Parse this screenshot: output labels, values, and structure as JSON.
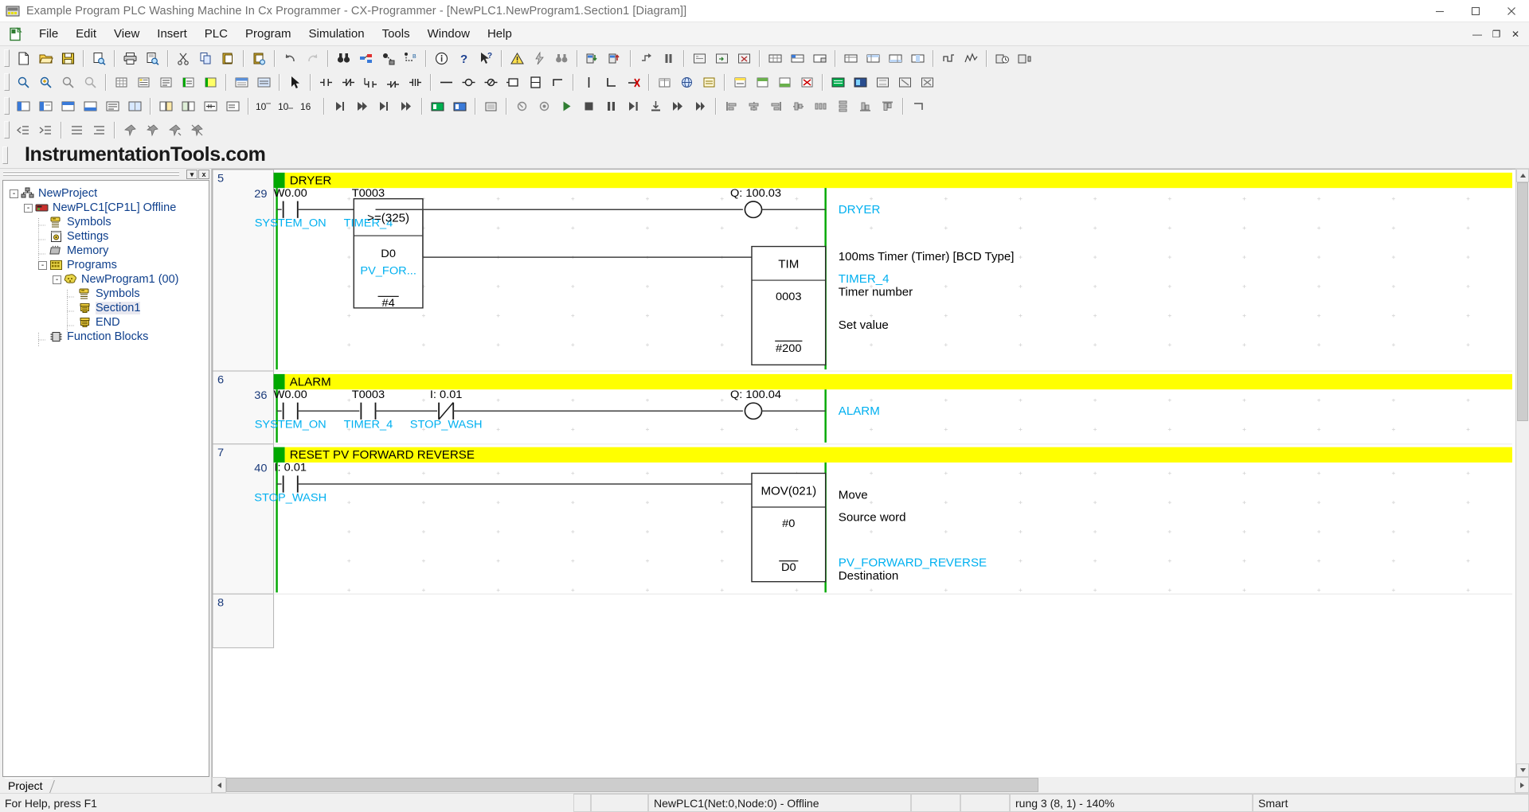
{
  "window": {
    "title": "Example Program PLC Washing Machine In Cx Programmer - CX-Programmer - [NewPLC1.NewProgram1.Section1 [Diagram]]",
    "app_icon": "plc-app-icon",
    "minimize": "minimize-icon",
    "maximize": "maximize-icon",
    "close": "close-icon"
  },
  "menubar": {
    "doc_icon": "document-icon",
    "items": [
      {
        "label": "File"
      },
      {
        "label": "Edit"
      },
      {
        "label": "View"
      },
      {
        "label": "Insert"
      },
      {
        "label": "PLC"
      },
      {
        "label": "Program"
      },
      {
        "label": "Simulation"
      },
      {
        "label": "Tools"
      },
      {
        "label": "Window"
      },
      {
        "label": "Help"
      }
    ],
    "mdi": [
      {
        "name": "mdi-minimize",
        "glyph": "—"
      },
      {
        "name": "mdi-restore",
        "glyph": "❐"
      },
      {
        "name": "mdi-close",
        "glyph": "✕"
      }
    ]
  },
  "brand": {
    "text": "InstrumentationTools.com"
  },
  "toolbars": {
    "row1": [
      {
        "name": "new-file-button",
        "icon": "new-document-icon"
      },
      {
        "name": "open-file-button",
        "icon": "open-folder-icon"
      },
      {
        "name": "save-file-button",
        "icon": "floppy-save-icon"
      },
      {
        "sep": true
      },
      {
        "name": "print-setup-button",
        "icon": "page-magnifier-icon"
      },
      {
        "sep": true
      },
      {
        "name": "print-button",
        "icon": "printer-icon"
      },
      {
        "name": "print-preview-button",
        "icon": "preview-page-icon"
      },
      {
        "sep": true
      },
      {
        "name": "cut-button",
        "icon": "scissors-icon"
      },
      {
        "name": "copy-button",
        "icon": "copy-icon"
      },
      {
        "name": "paste-button",
        "icon": "clipboard-paste-icon"
      },
      {
        "sep": true
      },
      {
        "name": "paste-special-button",
        "icon": "clipboard-special-icon"
      },
      {
        "sep": true
      },
      {
        "name": "undo-button",
        "icon": "undo-arrow-icon"
      },
      {
        "name": "redo-button",
        "icon": "redo-arrow-icon"
      },
      {
        "sep": true
      },
      {
        "name": "find-button",
        "icon": "binoculars-icon"
      },
      {
        "name": "replace-button",
        "icon": "find-replace-icon"
      },
      {
        "name": "go-to-button",
        "icon": "jump-to-icon"
      },
      {
        "name": "cross-reference-button",
        "icon": "cross-reference-icon"
      },
      {
        "sep": true
      },
      {
        "name": "properties-button",
        "icon": "info-circle-icon"
      },
      {
        "name": "help-button",
        "icon": "question-mark-icon"
      },
      {
        "name": "context-help-button",
        "icon": "help-pointer-icon"
      },
      {
        "sep": true
      },
      {
        "name": "compile-warning-button",
        "icon": "warning-triangle-icon"
      },
      {
        "name": "program-check-button",
        "icon": "lightning-check-icon"
      },
      {
        "name": "error-search-button",
        "icon": "error-search-icon"
      },
      {
        "sep": true
      },
      {
        "name": "transfer-to-plc-button",
        "icon": "download-plc-icon"
      },
      {
        "name": "transfer-from-plc-button",
        "icon": "upload-plc-icon"
      },
      {
        "sep": true
      },
      {
        "name": "step-run-button",
        "icon": "step-run-icon"
      },
      {
        "name": "pause-button",
        "icon": "pause-icon"
      },
      {
        "sep": true
      },
      {
        "name": "online-edit-begin-button",
        "icon": "online-edit-icon"
      },
      {
        "name": "online-edit-send-button",
        "icon": "online-send-icon"
      },
      {
        "name": "online-edit-cancel-button",
        "icon": "online-cancel-icon"
      },
      {
        "sep": true
      },
      {
        "name": "memory-view-button",
        "icon": "memory-view-icon"
      },
      {
        "name": "memory-edit-button",
        "icon": "memory-edit-icon"
      },
      {
        "name": "memory-transfer-button",
        "icon": "memory-transfer-icon"
      },
      {
        "sep": true
      },
      {
        "name": "watch-window-button",
        "icon": "watch-window-icon"
      },
      {
        "name": "watch-window-b-button",
        "icon": "watch-window-b-icon"
      },
      {
        "name": "watch-window-c-button",
        "icon": "watch-window-c-icon"
      },
      {
        "name": "watch-window-d-button",
        "icon": "watch-window-d-icon"
      },
      {
        "sep": true
      },
      {
        "name": "differential-monitor-button",
        "icon": "differential-monitor-icon"
      },
      {
        "name": "data-trace-button",
        "icon": "data-trace-icon"
      },
      {
        "sep": true
      },
      {
        "name": "plc-clock-button",
        "icon": "plc-clock-icon"
      },
      {
        "name": "plc-settings-button",
        "icon": "plc-settings-icon"
      }
    ],
    "row2": [
      {
        "name": "zoom-pointer-button",
        "icon": "zoom-pointer-icon"
      },
      {
        "name": "zoom-in-button",
        "icon": "zoom-in-icon"
      },
      {
        "name": "zoom-out-button",
        "icon": "zoom-out-icon"
      },
      {
        "name": "zoom-fit-button",
        "icon": "zoom-fit-icon"
      },
      {
        "sep": true
      },
      {
        "name": "toggle-grid-button",
        "icon": "grid-icon"
      },
      {
        "name": "show-symbols-button",
        "icon": "symbol-list-icon"
      },
      {
        "name": "show-comments-button",
        "icon": "comment-list-icon"
      },
      {
        "name": "show-rung-comments-button",
        "icon": "rung-comment-icon"
      },
      {
        "name": "show-bar-button",
        "icon": "bar-icon"
      },
      {
        "sep": true
      },
      {
        "name": "address-display-button",
        "icon": "address-display-icon"
      },
      {
        "name": "monitor-display-button",
        "icon": "monitor-display-icon"
      },
      {
        "sep": true
      },
      {
        "name": "select-mode-button",
        "icon": "arrow-cursor-icon"
      },
      {
        "sep": true
      },
      {
        "name": "new-contact-button",
        "icon": "contact-no-icon"
      },
      {
        "name": "new-closed-contact-button",
        "icon": "contact-nc-icon"
      },
      {
        "name": "new-contact-or-button",
        "icon": "contact-or-icon"
      },
      {
        "name": "new-closed-contact-or-button",
        "icon": "contact-or-nc-icon"
      },
      {
        "name": "new-contact-ud-button",
        "icon": "contact-ud-icon"
      },
      {
        "sep": true
      },
      {
        "name": "new-horizontal-line-button",
        "icon": "horizontal-line-icon"
      },
      {
        "name": "new-coil-button",
        "icon": "coil-icon"
      },
      {
        "name": "new-closed-coil-button",
        "icon": "coil-nc-icon"
      },
      {
        "name": "new-instruction-button",
        "icon": "instruction-box-icon"
      },
      {
        "name": "new-vertical-instruction-button",
        "icon": "vertical-instruction-icon"
      },
      {
        "name": "new-inline-instruction-button",
        "icon": "inline-instruction-icon"
      },
      {
        "sep": true
      },
      {
        "name": "new-vertical-line-button",
        "icon": "vertical-line-icon"
      },
      {
        "name": "new-corner-line-button",
        "icon": "corner-line-icon"
      },
      {
        "name": "delete-line-button",
        "icon": "delete-line-icon"
      },
      {
        "sep": true
      },
      {
        "name": "symbol-table-button",
        "icon": "symbol-table-icon"
      },
      {
        "name": "global-symbols-button",
        "icon": "global-symbols-icon"
      },
      {
        "name": "local-symbols-button",
        "icon": "local-symbols-icon"
      },
      {
        "sep": true
      },
      {
        "name": "insert-rung-button",
        "icon": "insert-rung-icon"
      },
      {
        "name": "insert-rung-above-button",
        "icon": "insert-rung-above-icon"
      },
      {
        "name": "insert-rung-below-button",
        "icon": "insert-rung-below-icon"
      },
      {
        "name": "delete-rung-button",
        "icon": "delete-rung-icon"
      },
      {
        "sep": true
      },
      {
        "name": "mnemonic-view-button",
        "icon": "mnemonic-view-icon"
      },
      {
        "name": "toggle-bit-button",
        "icon": "toggle-bit-icon"
      },
      {
        "name": "force-on-button",
        "icon": "force-on-icon"
      },
      {
        "name": "force-off-button",
        "icon": "force-off-icon"
      },
      {
        "name": "force-cancel-button",
        "icon": "force-cancel-icon"
      }
    ],
    "row3": [
      {
        "name": "show-program-button",
        "icon": "show-program-icon"
      },
      {
        "name": "show-section-button",
        "icon": "show-section-icon"
      },
      {
        "name": "show-symbol-button",
        "icon": "show-symbol-icon"
      },
      {
        "name": "show-comment-button",
        "icon": "show-comment-icon"
      },
      {
        "name": "show-output-button",
        "icon": "show-output-icon"
      },
      {
        "name": "show-watch-button",
        "icon": "show-watch-icon"
      },
      {
        "sep": true
      },
      {
        "name": "compare-program-button",
        "icon": "compare-program-icon"
      },
      {
        "name": "compare-section-button",
        "icon": "compare-section-icon"
      },
      {
        "name": "view-ladder-button",
        "icon": "view-ladder-icon"
      },
      {
        "name": "view-mnemonics-button",
        "icon": "view-mnemonics-icon"
      },
      {
        "sep": true
      },
      {
        "name": "display-decimal-10-button",
        "icon": "decimal-10-icon",
        "label": "10"
      },
      {
        "name": "display-signed-10-button",
        "icon": "signed-10-icon",
        "label": "10"
      },
      {
        "name": "display-hex-16-button",
        "icon": "hex-16-icon",
        "label": "16"
      },
      {
        "sep": true
      },
      {
        "name": "jump-first-rung-button",
        "icon": "jump-first-icon"
      },
      {
        "name": "jump-prev-rung-button",
        "icon": "jump-prev-icon"
      },
      {
        "name": "jump-next-rung-button",
        "icon": "jump-next-icon"
      },
      {
        "name": "jump-last-rung-button",
        "icon": "jump-last-icon"
      },
      {
        "sep": true
      },
      {
        "name": "work-online-button",
        "icon": "work-online-icon"
      },
      {
        "name": "work-online-simulator-button",
        "icon": "simulator-online-icon"
      },
      {
        "sep": true
      },
      {
        "name": "plc-mode-button",
        "icon": "plc-mode-icon"
      },
      {
        "sep": true
      },
      {
        "name": "sim-stop-mode-button",
        "icon": "sim-stop-mode-icon"
      },
      {
        "name": "sim-monitor-mode-button",
        "icon": "sim-monitor-mode-icon"
      },
      {
        "name": "sim-run-button",
        "icon": "sim-run-icon"
      },
      {
        "name": "sim-stop-button",
        "icon": "sim-stop-icon"
      },
      {
        "name": "sim-pause-button",
        "icon": "sim-pause-icon"
      },
      {
        "name": "sim-step-button",
        "icon": "sim-step-icon"
      },
      {
        "name": "sim-step-in-button",
        "icon": "sim-step-in-icon"
      },
      {
        "name": "sim-continuous-step-button",
        "icon": "sim-continuous-step-icon"
      },
      {
        "name": "sim-scan-button",
        "icon": "sim-scan-icon"
      },
      {
        "sep": true
      },
      {
        "name": "align-left-button",
        "icon": "align-left-icon"
      },
      {
        "name": "align-center-button",
        "icon": "align-center-icon"
      },
      {
        "name": "align-right-button",
        "icon": "align-right-icon"
      },
      {
        "name": "align-mid-button",
        "icon": "align-mid-icon"
      },
      {
        "name": "space-across-button",
        "icon": "space-across-icon"
      },
      {
        "name": "space-down-button",
        "icon": "space-down-icon"
      },
      {
        "name": "align-bottom-button",
        "icon": "align-bottom-icon"
      },
      {
        "name": "align-top-button",
        "icon": "align-top-icon"
      },
      {
        "sep": true
      },
      {
        "name": "corner-tool-button",
        "icon": "corner-tool-icon"
      }
    ],
    "row4": [
      {
        "name": "indent-decrease-button",
        "icon": "indent-decrease-icon"
      },
      {
        "name": "indent-increase-button",
        "icon": "indent-increase-icon"
      },
      {
        "sep": true
      },
      {
        "name": "list-left-button",
        "icon": "list-left-icon"
      },
      {
        "name": "list-right-button",
        "icon": "list-right-icon"
      },
      {
        "sep": true
      },
      {
        "name": "pin-button",
        "icon": "pin-icon"
      },
      {
        "name": "pin-remove-button",
        "icon": "pin-remove-icon"
      },
      {
        "name": "pin-add-button",
        "icon": "pin-add-icon"
      },
      {
        "name": "pin-clear-button",
        "icon": "pin-clear-icon"
      }
    ]
  },
  "project_panel": {
    "close_button": "close-panel-icon",
    "dropdown_button": "panel-dropdown-icon",
    "tab_label": "Project",
    "tree": [
      {
        "label": "NewProject",
        "icon": "project-network-icon",
        "depth": 0,
        "expander": "-"
      },
      {
        "label": "NewPLC1[CP1L] Offline",
        "icon": "plc-device-icon",
        "depth": 1,
        "expander": "-"
      },
      {
        "label": "Symbols",
        "icon": "symbols-icon",
        "depth": 2,
        "expander": ""
      },
      {
        "label": "Settings",
        "icon": "settings-icon",
        "depth": 2,
        "expander": ""
      },
      {
        "label": "Memory",
        "icon": "memory-chip-icon",
        "depth": 2,
        "expander": ""
      },
      {
        "label": "Programs",
        "icon": "programs-icon",
        "depth": 2,
        "expander": "-"
      },
      {
        "label": "NewProgram1 (00)",
        "icon": "program-icon",
        "depth": 3,
        "expander": "-"
      },
      {
        "label": "Symbols",
        "icon": "symbols-icon",
        "depth": 4,
        "expander": ""
      },
      {
        "label": "Section1",
        "icon": "section-icon",
        "depth": 4,
        "expander": "",
        "selected": true
      },
      {
        "label": "END",
        "icon": "section-icon",
        "depth": 4,
        "expander": ""
      },
      {
        "label": "Function Blocks",
        "icon": "function-block-icon",
        "depth": 2,
        "expander": ""
      }
    ]
  },
  "ladder": {
    "colors": {
      "rail": "#00a800",
      "comment_bar": "#ffff00",
      "comment_marker": "#00a800",
      "symbol_text": "#00b0f0",
      "address_text": "#000000",
      "annotation_text": "#000000",
      "wire": "#606060"
    },
    "rungs": [
      {
        "number": "5",
        "address": "29",
        "comment": "DRYER",
        "contacts": [
          {
            "address": "W0.00",
            "symbol": "SYSTEM_ON",
            "type": "NO"
          },
          {
            "address": "T0003",
            "symbol": "TIMER_4",
            "type": "NC"
          }
        ],
        "compare_block": {
          "instruction": ">=(325)",
          "operand1": "D0",
          "operand1_symbol": "PV_FOR...",
          "operand2": "#4"
        },
        "coil": {
          "address": "Q: 100.03",
          "symbol": "DRYER"
        },
        "timer_block": {
          "instruction": "TIM",
          "operand1": "0003",
          "operand2": "#200",
          "annotations": [
            {
              "text": "100ms Timer (Timer) [BCD Type]",
              "kind": "desc"
            },
            {
              "text": "TIMER_4",
              "kind": "symbol"
            },
            {
              "text": "Timer number",
              "kind": "desc"
            },
            {
              "text": "Set value",
              "kind": "desc"
            }
          ]
        }
      },
      {
        "number": "6",
        "address": "36",
        "comment": "ALARM",
        "contacts": [
          {
            "address": "W0.00",
            "symbol": "SYSTEM_ON",
            "type": "NO"
          },
          {
            "address": "T0003",
            "symbol": "TIMER_4",
            "type": "NO"
          },
          {
            "address": "I: 0.01",
            "symbol": "STOP_WASH",
            "type": "NC"
          }
        ],
        "coil": {
          "address": "Q: 100.04",
          "symbol": "ALARM"
        }
      },
      {
        "number": "7",
        "address": "40",
        "comment": "RESET PV FORWARD REVERSE",
        "contacts": [
          {
            "address": "I: 0.01",
            "symbol": "STOP_WASH",
            "type": "NO"
          }
        ],
        "mov_block": {
          "instruction": "MOV(021)",
          "operand1": "#0",
          "operand2": "D0",
          "annotations": [
            {
              "text": "Move",
              "kind": "desc"
            },
            {
              "text": "Source word",
              "kind": "desc"
            },
            {
              "text": "PV_FORWARD_REVERSE",
              "kind": "symbol"
            },
            {
              "text": "Destination",
              "kind": "desc"
            }
          ]
        }
      },
      {
        "number": "8",
        "address": "",
        "comment": "",
        "contacts": [],
        "empty": true
      }
    ]
  },
  "scrollbars": {
    "v_up": "scroll-up-arrow-icon",
    "v_down": "scroll-down-arrow-icon",
    "h_left": "scroll-left-arrow-icon",
    "h_right": "scroll-right-arrow-icon"
  },
  "statusbar": {
    "help_text": "For Help, press F1",
    "plc_status": "NewPLC1(Net:0,Node:0) - Offline",
    "rung_info": "rung 3 (8, 1)  -  140%",
    "mode": "Smart"
  }
}
